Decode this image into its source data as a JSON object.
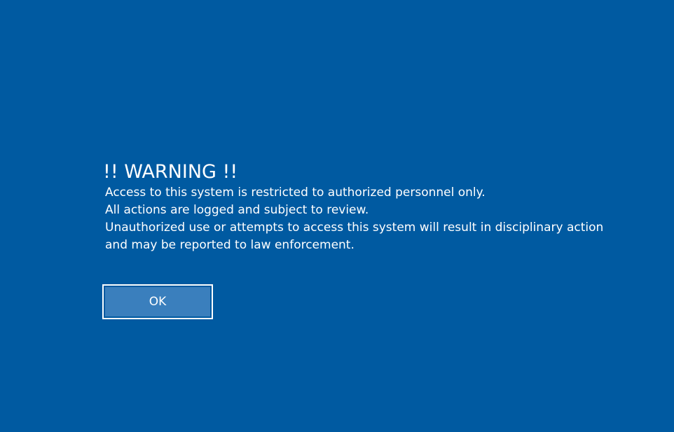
{
  "notice": {
    "title": "!! WARNING !!",
    "lines": [
      "Access to this system is restricted to authorized personnel only.",
      "All actions are logged and subject to review.",
      "Unauthorized use or attempts to access this system will result in disciplinary action",
      "and may be reported to law enforcement."
    ]
  },
  "ok_button": {
    "label": "OK"
  },
  "colors": {
    "background": "#005aa1",
    "button_fill": "#3a7fbd",
    "text": "#ffffff"
  }
}
